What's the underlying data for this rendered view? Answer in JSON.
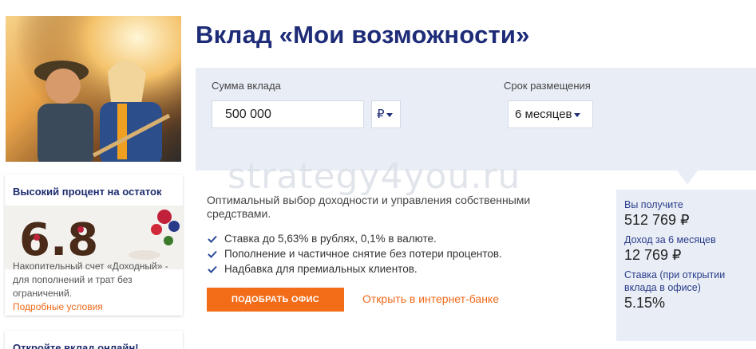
{
  "page_title": "Вклад «Мои возможности»",
  "calculator": {
    "amount_label": "Сумма вклада",
    "amount_value": "500 000",
    "currency": "₽",
    "term_label": "Срок размещения",
    "term_value": "6 месяцев"
  },
  "description": "Оптимальный выбор доходности и управления собственными средствами.",
  "features": [
    "Ставка до 5,63% в рублях, 0,1% в валюте.",
    "Пополнение и частичное снятие без потери процентов.",
    "Надбавка для премиальных клиентов."
  ],
  "actions": {
    "find_office": "Подобрать офис",
    "internet_bank": "Открыть в интернет-банке"
  },
  "result": {
    "receive_label": "Вы получите",
    "receive_value": "512 769 ₽",
    "income_label": "Доход за 6 месяцев",
    "income_value": "12 769 ₽",
    "rate_label": "Ставка (при открытии вклада в офисе)",
    "rate_value": "5.15%"
  },
  "promos": [
    {
      "title": "Высокий процент на остаток",
      "image_text": "6.8",
      "description": "Накопительный счет «Доходный» - для пополнений и трат без ограничений.",
      "link": "Подробные условия"
    },
    {
      "title": "Откройте вклад онлайн!"
    }
  ],
  "watermark": "strategy4you.ru",
  "colors": {
    "brand_blue": "#1e2c78",
    "accent_orange": "#f36c18",
    "panel_bg": "#e9eef6"
  },
  "icons": {
    "check": "check-icon",
    "caret": "chevron-down-icon"
  }
}
